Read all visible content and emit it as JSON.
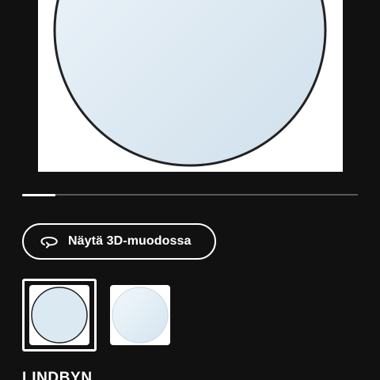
{
  "product": {
    "name": "LINDBYN",
    "image_alt": "round mirror"
  },
  "gallery": {
    "view_3d_label": "Näytä 3D-muodossa",
    "progress_fraction": 0.1,
    "thumbnails": [
      {
        "name": "mirror-with-frame",
        "selected": true
      },
      {
        "name": "mirror-glass",
        "selected": false
      }
    ]
  },
  "icons": {
    "view_3d": "rotate-3d-icon"
  },
  "colors": {
    "background": "#111111",
    "accent": "#ffffff",
    "track": "#5a5a5a",
    "mirror_frame": "#222222",
    "mirror_glass": "#dbe9f2"
  }
}
